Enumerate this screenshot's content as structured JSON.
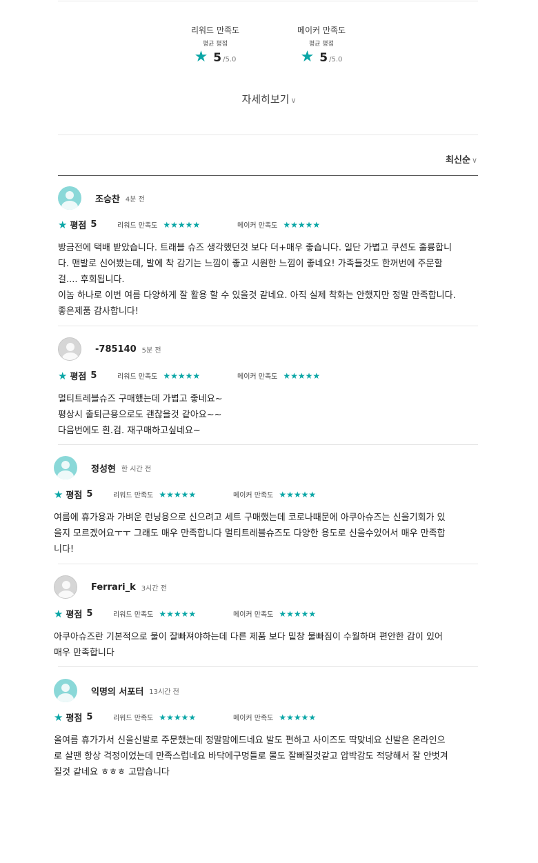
{
  "summary": {
    "reward": {
      "title": "리워드 만족도",
      "subtitle": "평균 평점",
      "score": "5",
      "max": "/5.0"
    },
    "maker": {
      "title": "메이커 만족도",
      "subtitle": "평균 평점",
      "score": "5",
      "max": "/5.0"
    }
  },
  "more_label": "자세히보기",
  "sort_label": "최신순",
  "labels": {
    "rating": "평점",
    "reward_sat": "리워드 만족도",
    "maker_sat": "메이커 만족도"
  },
  "colors": {
    "accent": "#0aa6a6"
  },
  "reviews": [
    {
      "name": "조승찬",
      "time": "4분 전",
      "rating": "5",
      "avatar": "teal",
      "lines": [
        "방금전에 택배 받았습니다. 트래블 슈즈 생각했던것 보다 더+매우 좋습니다. 일단 가볍고 쿠션도 훌륭합니",
        "다. 맨발로 신어봤는데, 발에 착 감기는 느낌이 좋고 시원한 느낌이 좋네요! 가족들것도 한꺼번에 주문할",
        "걸.... 후회됩니다.",
        "이놈 하나로 이번 여름 다양하게 잘 활용 할 수 있을것 같네요. 아직 실제 착화는 안했지만 정말 만족합니다.",
        "좋은제품 감사합니다!"
      ]
    },
    {
      "name": "-785140",
      "time": "5분 전",
      "rating": "5",
      "avatar": "grey",
      "lines": [
        "멀티트레블슈즈 구매했는데 가볍고 좋네요~",
        "평상시 출퇴근용으로도 괜찮을것 같아요~~",
        "다음번에도 흰.검. 재구매하고싶네요~"
      ]
    },
    {
      "name": "정성현",
      "time": "한 시간 전",
      "rating": "5",
      "avatar": "teal",
      "lines": [
        "여름에 휴가용과 가벼운 런닝용으로 신으려고 세트 구매했는데 코로나때문에 아쿠아슈즈는 신을기회가 있",
        "을지 모르겠어요ㅜㅜ 그래도 매우 만족합니다 멀티트레블슈즈도 다양한 용도로 신을수있어서 매우 만족합",
        "니다!"
      ]
    },
    {
      "name": "Ferrari_k",
      "time": "3시간 전",
      "rating": "5",
      "avatar": "grey",
      "lines": [
        "아쿠아슈즈란 기본적으로 물이 잘빠져야하는데 다른 제품 보다 밑창 물빠짐이 수월하며 편안한 감이 있어",
        "매우 만족합니다"
      ]
    },
    {
      "name": "익명의 서포터",
      "time": "13시간 전",
      "rating": "5",
      "avatar": "teal",
      "lines": [
        "올여름 휴가가서 신을신발로 주문했는데 정말맘에드네요 발도 편하고 사이즈도 딱맞네요 신발은 온라인으",
        "로 살땐 항상 걱정이었는데 만족스럽네요 바닥에구멍들로 물도 잘빠질것같고 압박감도 적당해서 잘 안벗겨",
        "질것 같네요 ㅎㅎㅎ 고맙습니다"
      ]
    }
  ]
}
